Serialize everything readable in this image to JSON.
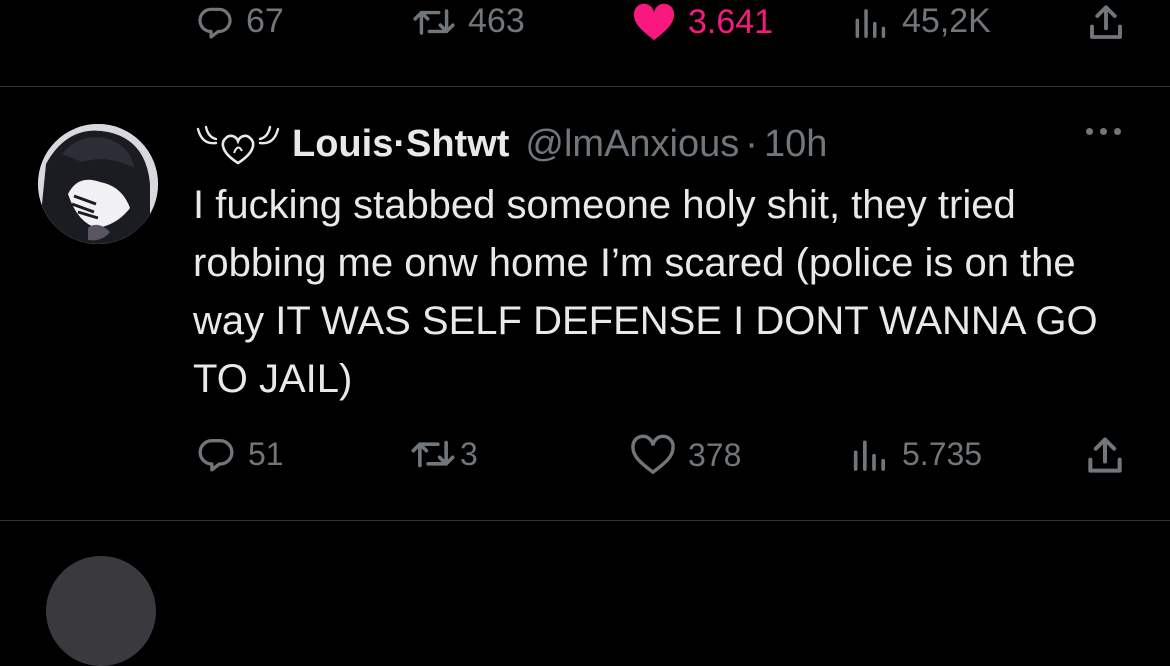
{
  "top_actions": {
    "replies": "67",
    "retweets": "463",
    "likes": "3.641",
    "views": "45,2K",
    "colors": {
      "liked": "#f91880",
      "muted": "#71767b"
    }
  },
  "tweet": {
    "display_name": "Louis·Shtwt",
    "handle": "@lmAnxious",
    "separator": "·",
    "time": "10h",
    "text": "I fucking stabbed someone holy shit, they tried robbing me onw home I’m scared (police is on the way IT WAS SELF DEFENSE I DONT WANNA GO TO JAIL)",
    "actions": {
      "replies": "51",
      "retweets": "3",
      "likes": "378",
      "views": "5.735"
    }
  },
  "icons": [
    "reply-icon",
    "retweet-icon",
    "like-icon",
    "views-icon",
    "share-icon",
    "more-icon",
    "decorative-heart-wings-icon"
  ],
  "colors": {
    "background": "#000000",
    "text": "#e7e9ea",
    "muted": "#71767b",
    "divider": "#2f3336"
  }
}
